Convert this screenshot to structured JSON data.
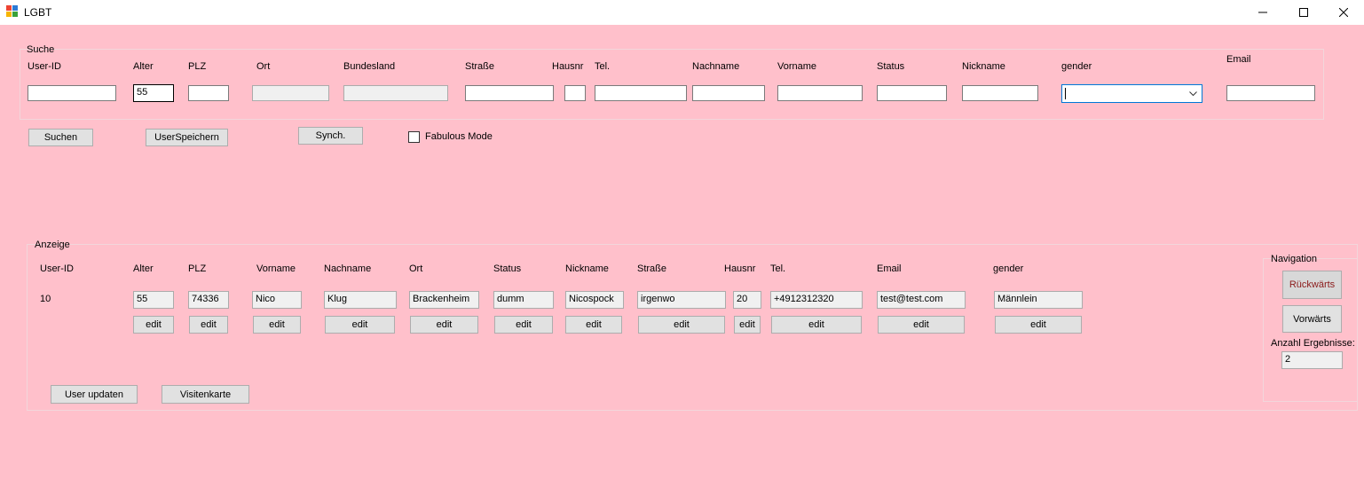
{
  "window": {
    "title": "LGBT"
  },
  "search": {
    "group_label": "Suche",
    "fields": [
      {
        "key": "userid",
        "label": "User-ID",
        "value": ""
      },
      {
        "key": "alter",
        "label": "Alter",
        "value": "55"
      },
      {
        "key": "plz",
        "label": "PLZ",
        "value": ""
      },
      {
        "key": "ort",
        "label": "Ort",
        "value": ""
      },
      {
        "key": "bundesland",
        "label": "Bundesland",
        "value": ""
      },
      {
        "key": "strasse",
        "label": "Straße",
        "value": ""
      },
      {
        "key": "hausnr",
        "label": "Hausnr",
        "value": ""
      },
      {
        "key": "tel",
        "label": "Tel.",
        "value": ""
      },
      {
        "key": "nachname",
        "label": "Nachname",
        "value": ""
      },
      {
        "key": "vorname",
        "label": "Vorname",
        "value": ""
      },
      {
        "key": "status",
        "label": "Status",
        "value": ""
      },
      {
        "key": "nickname",
        "label": "Nickname",
        "value": ""
      },
      {
        "key": "gender",
        "label": "gender",
        "value": ""
      },
      {
        "key": "email",
        "label": "Email",
        "value": ""
      }
    ],
    "buttons": {
      "suchen": "Suchen",
      "speichern": "UserSpeichern",
      "synch": "Synch."
    },
    "fabulous_mode": {
      "label": "Fabulous Mode",
      "checked": false
    }
  },
  "display": {
    "group_label": "Anzeige",
    "userid_label": "User-ID",
    "userid_value": "10",
    "fields": [
      {
        "key": "alter",
        "label": "Alter",
        "value": "55"
      },
      {
        "key": "plz",
        "label": "PLZ",
        "value": "74336"
      },
      {
        "key": "vorname",
        "label": "Vorname",
        "value": "Nico"
      },
      {
        "key": "nachname",
        "label": "Nachname",
        "value": "Klug"
      },
      {
        "key": "ort",
        "label": "Ort",
        "value": "Brackenheim"
      },
      {
        "key": "status",
        "label": "Status",
        "value": "dumm"
      },
      {
        "key": "nickname",
        "label": "Nickname",
        "value": "Nicospock"
      },
      {
        "key": "strasse",
        "label": "Straße",
        "value": "irgenwo"
      },
      {
        "key": "hausnr",
        "label": "Hausnr",
        "value": "20"
      },
      {
        "key": "tel",
        "label": "Tel.",
        "value": "+4912312320"
      },
      {
        "key": "email",
        "label": "Email",
        "value": "test@test.com"
      },
      {
        "key": "gender",
        "label": "gender",
        "value": "Männlein"
      }
    ],
    "edit_label": "edit",
    "buttons": {
      "update": "User updaten",
      "visitenkarte": "Visitenkarte"
    }
  },
  "navigation": {
    "group_label": "Navigation",
    "back": "Rückwärts",
    "forward": "Vorwärts",
    "count_label": "Anzahl Ergebnisse:",
    "count_value": "2"
  },
  "colors": {
    "background": "#ffc0cb",
    "back_button_text": "#8b1a1a"
  }
}
